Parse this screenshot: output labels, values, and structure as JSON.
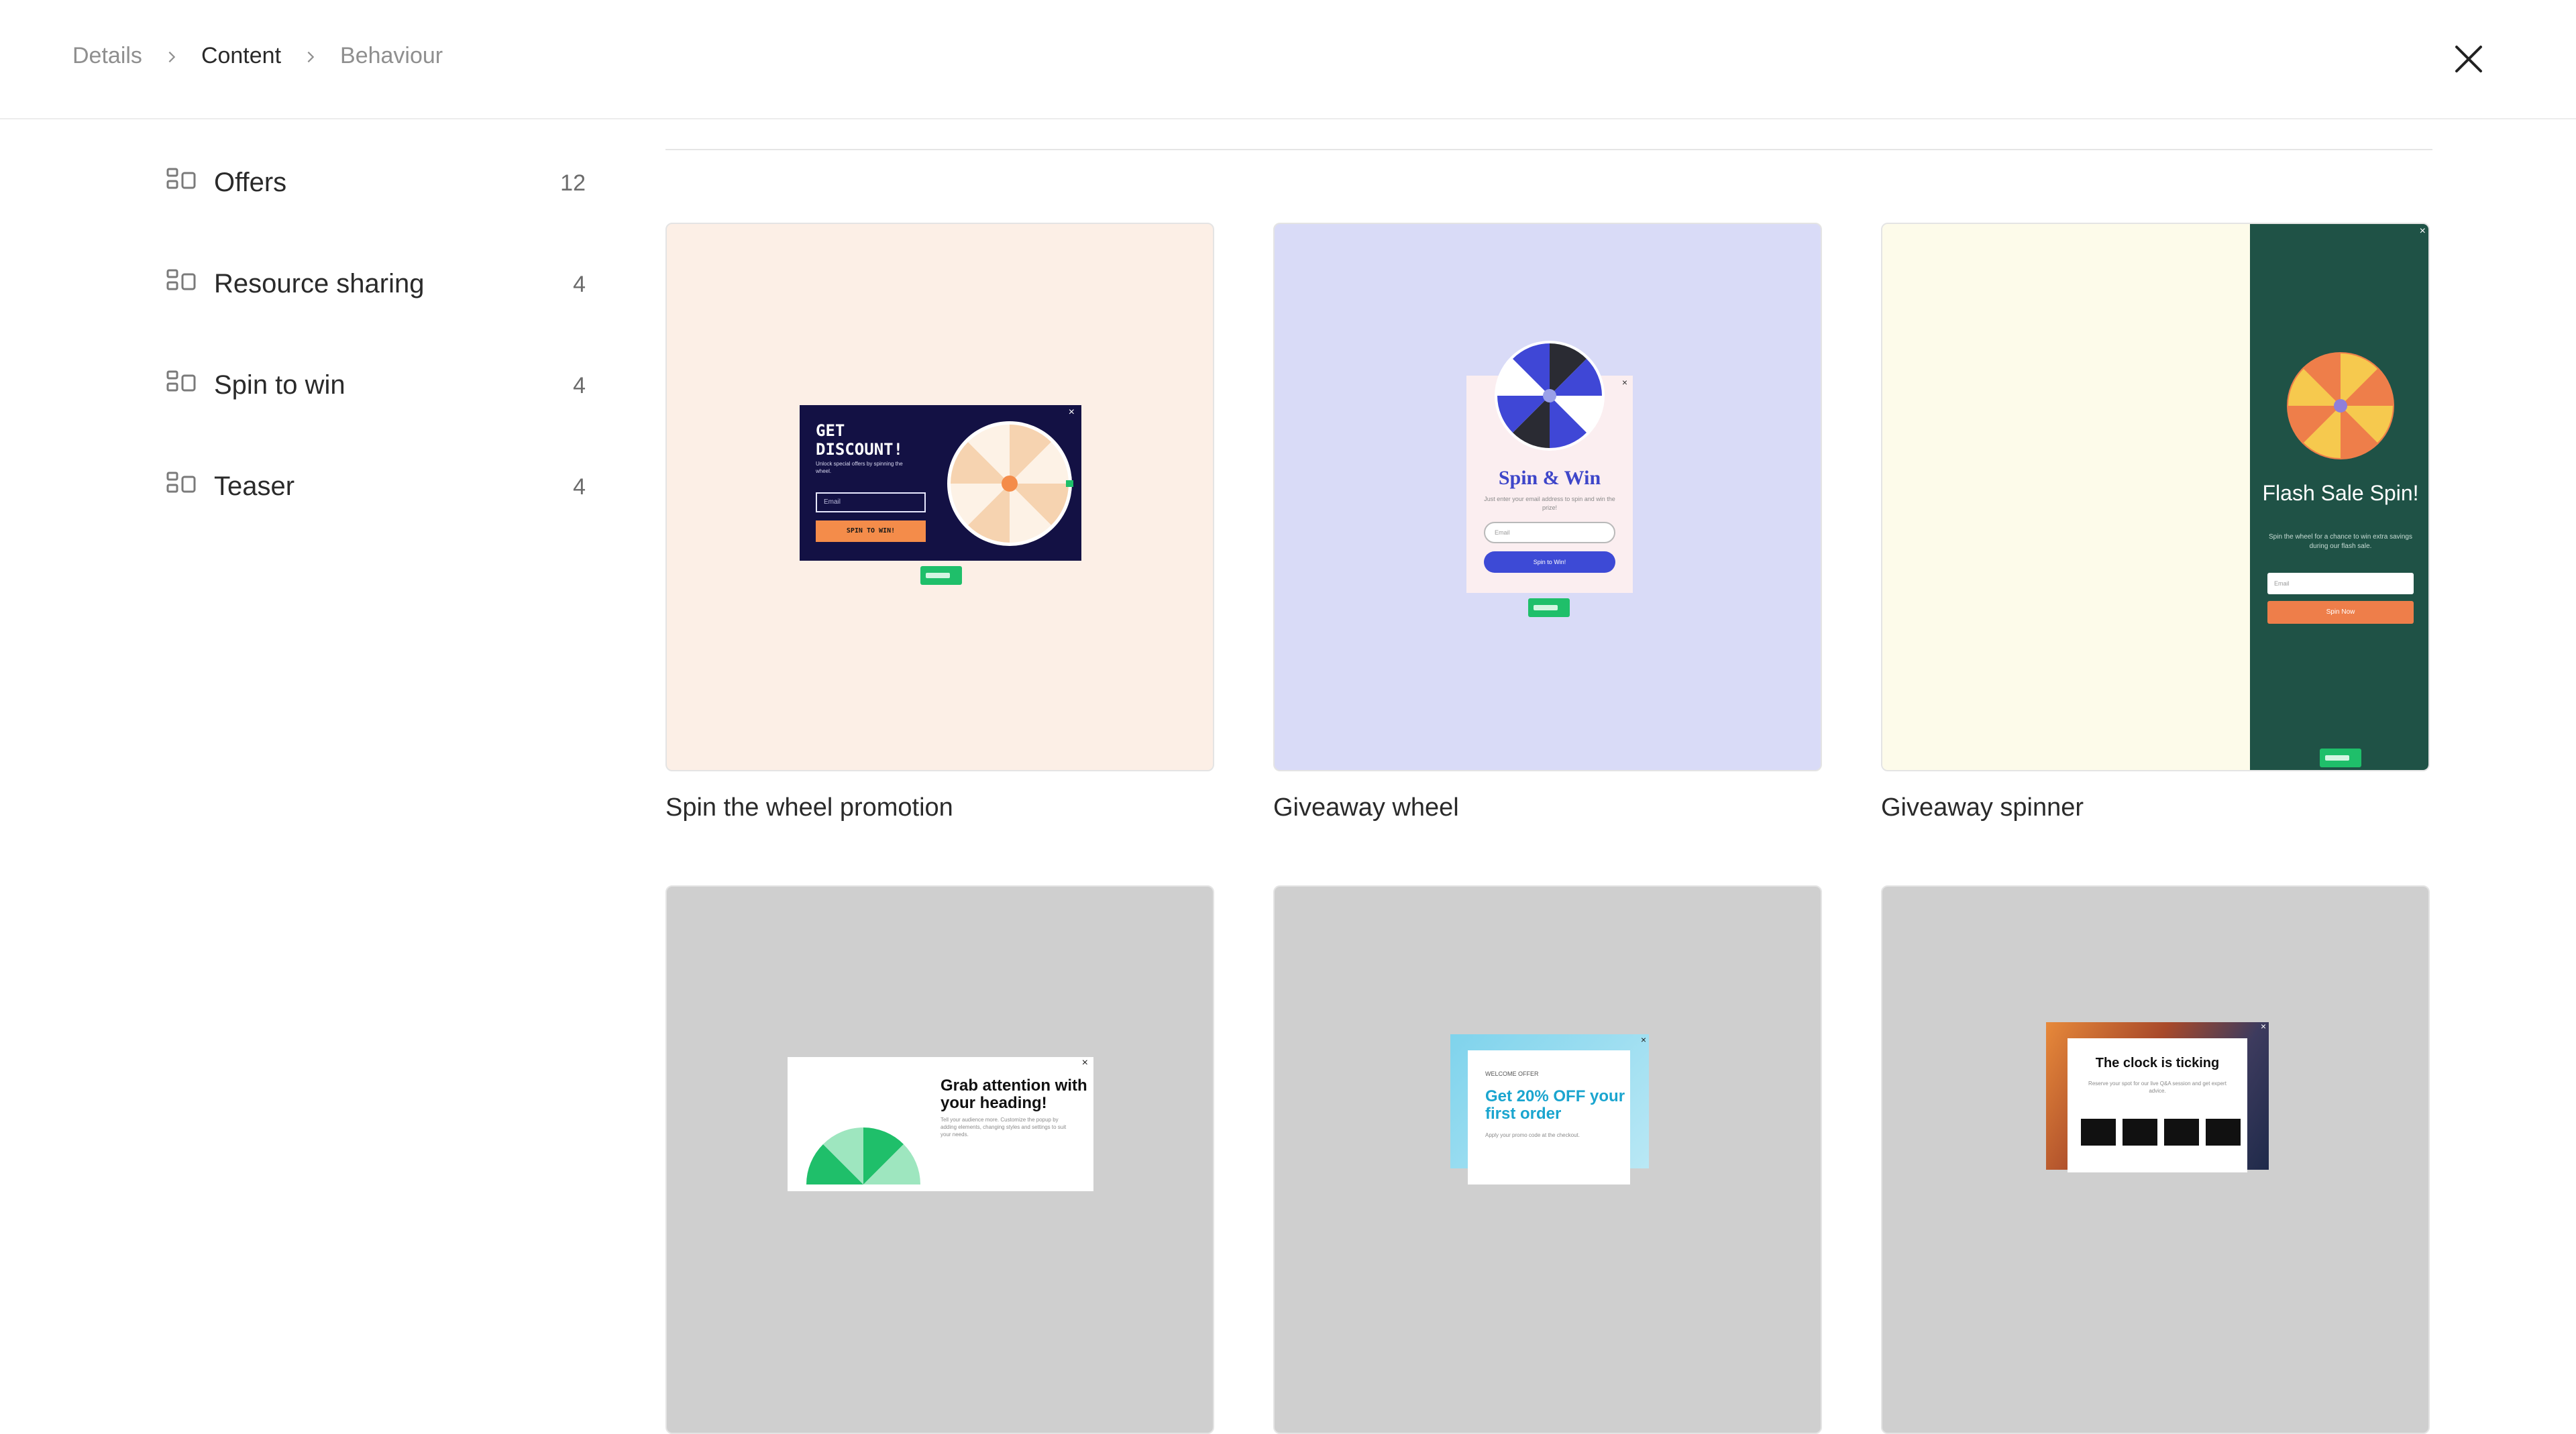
{
  "breadcrumb": {
    "items": [
      "Details",
      "Content",
      "Behaviour"
    ]
  },
  "sidebar": {
    "items": [
      {
        "label": "Offers",
        "count": "12"
      },
      {
        "label": "Resource sharing",
        "count": "4"
      },
      {
        "label": "Spin to win",
        "count": "4"
      },
      {
        "label": "Teaser",
        "count": "4"
      }
    ]
  },
  "templates": [
    {
      "title": "Spin the wheel promotion",
      "bg": "#fcefe6",
      "preview": {
        "heading": "GET DISCOUNT!",
        "sub": "Unlock special offers by spinning the wheel.",
        "input": "Email",
        "button": "SPIN TO WIN!"
      }
    },
    {
      "title": "Giveaway wheel",
      "bg": "#d9dbf7",
      "preview": {
        "heading": "Spin & Win",
        "sub": "Just enter your email address to spin and win the prize!",
        "input": "Email",
        "button": "Spin to Win!"
      }
    },
    {
      "title": "Giveaway spinner",
      "bg": "#fdfbea",
      "preview": {
        "heading": "Flash Sale Spin!",
        "sub": "Spin the wheel for a chance to win extra savings during our flash sale.",
        "input": "Email",
        "button": "Spin Now"
      }
    },
    {
      "preview": {
        "heading": "Grab attention with your heading!",
        "sub": "Tell your audience more. Customize the popup by adding elements, changing styles and settings to suit your needs."
      }
    },
    {
      "preview": {
        "small": "WELCOME OFFER",
        "heading": "Get 20% OFF your first order",
        "sub": "Apply your promo code at the checkout."
      }
    },
    {
      "preview": {
        "heading": "The clock is ticking",
        "sub": "Reserve your spot for our live Q&A session and get expert advice."
      }
    }
  ],
  "colors": {
    "accent_green": "#1fbf6a",
    "navy": "#131144",
    "orange": "#f48c4a",
    "indigo": "#3d4ad6",
    "teal_panel": "#1f5246"
  }
}
